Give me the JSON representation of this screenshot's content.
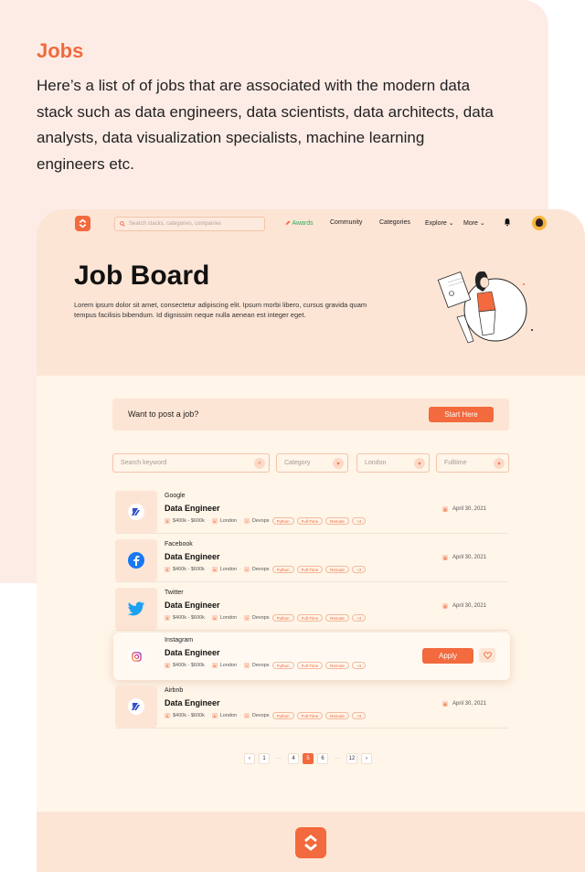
{
  "intro": {
    "title": "Jobs",
    "text": "Here’s a list of of jobs that are associated with the modern data stack such as data engineers, data scientists, data architects, data analysts, data visualization specialists, machine learning engineers etc."
  },
  "header": {
    "search_placeholder": "Search stacks, categories, companies",
    "nav": [
      "Awards",
      "Community",
      "Categories",
      "Explore",
      "More"
    ]
  },
  "hero": {
    "title": "Job Board",
    "description": "Lorem ipsum dolor sit amet, consectetur adipiscing elit. Ipsum morbi libero, cursus gravida quam tempus facilisis bibendum. Id dignissim neque nulla aenean est integer eget."
  },
  "post": {
    "label": "Want to post a job?",
    "button": "Start Here"
  },
  "filters": {
    "keyword_placeholder": "Search keyword",
    "category": "Category",
    "location": "London",
    "type": "Fulltime"
  },
  "jobs": [
    {
      "company": "Google",
      "title": "Data Engineer",
      "salary": "$400k - $600k",
      "location": "London",
      "team": "Devops",
      "tags": [
        "Python",
        "Full-Time",
        "Remote",
        "+3"
      ],
      "date": "April 30, 2021"
    },
    {
      "company": "Facebook",
      "title": "Data Engineer",
      "salary": "$400k - $600k",
      "location": "London",
      "team": "Devops",
      "tags": [
        "Python",
        "Full-Time",
        "Remote",
        "+3"
      ],
      "date": "April 30, 2021"
    },
    {
      "company": "Twitter",
      "title": "Data Engineer",
      "salary": "$400k - $600k",
      "location": "London",
      "team": "Devops",
      "tags": [
        "Python",
        "Full-Time",
        "Remote",
        "+3"
      ],
      "date": "April 30, 2021"
    },
    {
      "company": "Instagram",
      "title": "Data Engineer",
      "salary": "$400k - $600k",
      "location": "London",
      "team": "Devops",
      "tags": [
        "Python",
        "Full-Time",
        "Remote",
        "+3"
      ],
      "apply": "Apply"
    },
    {
      "company": "Airbnb",
      "title": "Data Engineer",
      "salary": "$400k - $600k",
      "location": "London",
      "team": "Devops",
      "tags": [
        "Python",
        "Full-Time",
        "Remote",
        "+3"
      ],
      "date": "April 30, 2021"
    }
  ],
  "pagination": {
    "prev": "‹",
    "pages": [
      "1",
      "···",
      "4",
      "5",
      "6",
      "···",
      "12"
    ],
    "current": "5",
    "next": "›"
  },
  "colors": {
    "accent": "#f26a3d",
    "peach": "#fde5d5",
    "cream": "#fff5e9"
  }
}
